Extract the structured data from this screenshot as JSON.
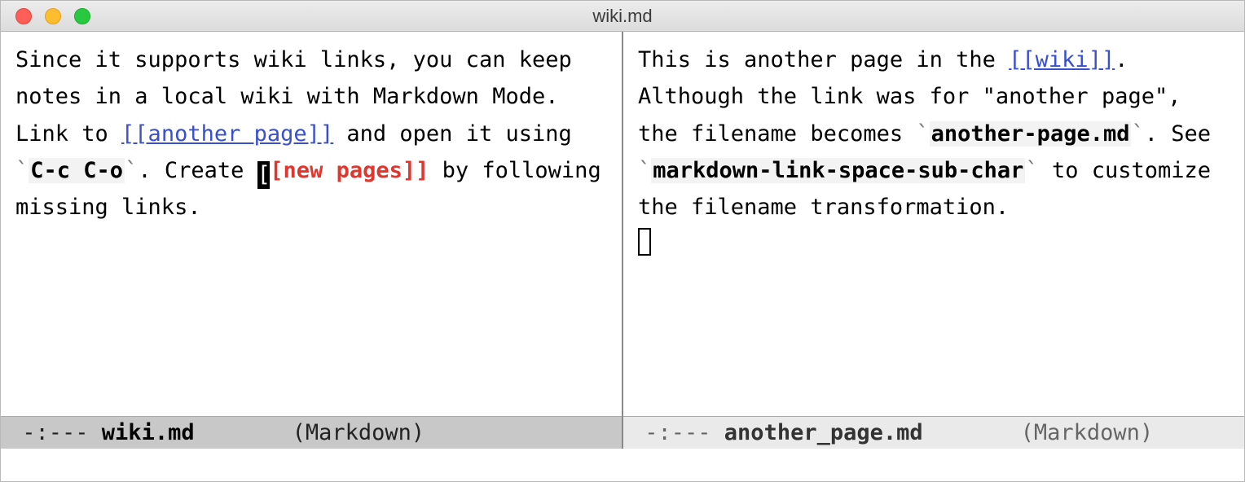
{
  "title": "wiki.md",
  "left": {
    "t1": "Since it supports wiki links, you can keep notes in a local wiki with Markdown Mode. Link to ",
    "link1": "[[another page]]",
    "t2": " and open it using ",
    "tick": "`",
    "code1": "C-c C-o",
    "t3": ".  Create ",
    "cursor_char": "[",
    "missing": "[new pages]]",
    "t4": " by following missing links.",
    "mode_prefix": " -:--- ",
    "mode_file": "wiki.md",
    "mode_major": "(Markdown)"
  },
  "right": {
    "t1": "This is another page in the ",
    "link1": "[[wiki]]",
    "t2": ". Although the link was for \"another page\", the filename becomes ",
    "tick": "`",
    "code1": "another-page.md",
    "t3": ". See ",
    "code2": "markdown-link-space-sub-char",
    "t4": " to customize the filename transformation.",
    "mode_prefix": " -:--- ",
    "mode_file": "another_page.md",
    "mode_major": "(Markdown)"
  }
}
